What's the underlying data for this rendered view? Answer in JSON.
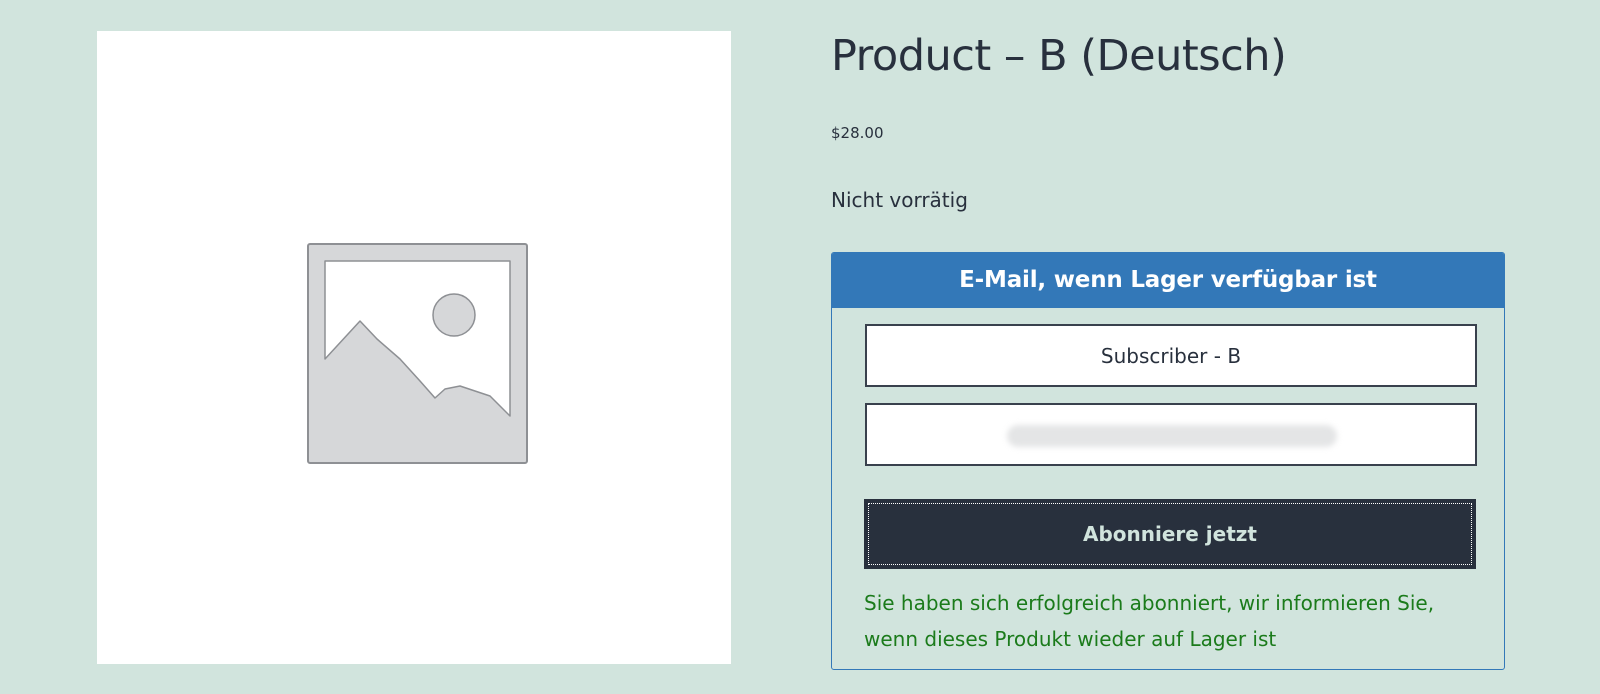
{
  "product": {
    "title": "Product – B (Deutsch)",
    "price": "$28.00",
    "stock_status": "Nicht vorrätig",
    "image_icon": "image-placeholder-icon"
  },
  "notify_form": {
    "header": "E-Mail, wenn Lager verfügbar ist",
    "name_value": "Subscriber - B",
    "email_value": "",
    "submit_label": "Abonniere jetzt",
    "success_message": "Sie haben sich erfolgreich abonniert, wir informieren Sie, wenn dieses Produkt wieder auf Lager ist"
  },
  "colors": {
    "page_background": "#d1e4dd",
    "header_blue": "#3378b8",
    "button_dark": "#28303d",
    "success_green": "#1b7b1b"
  }
}
